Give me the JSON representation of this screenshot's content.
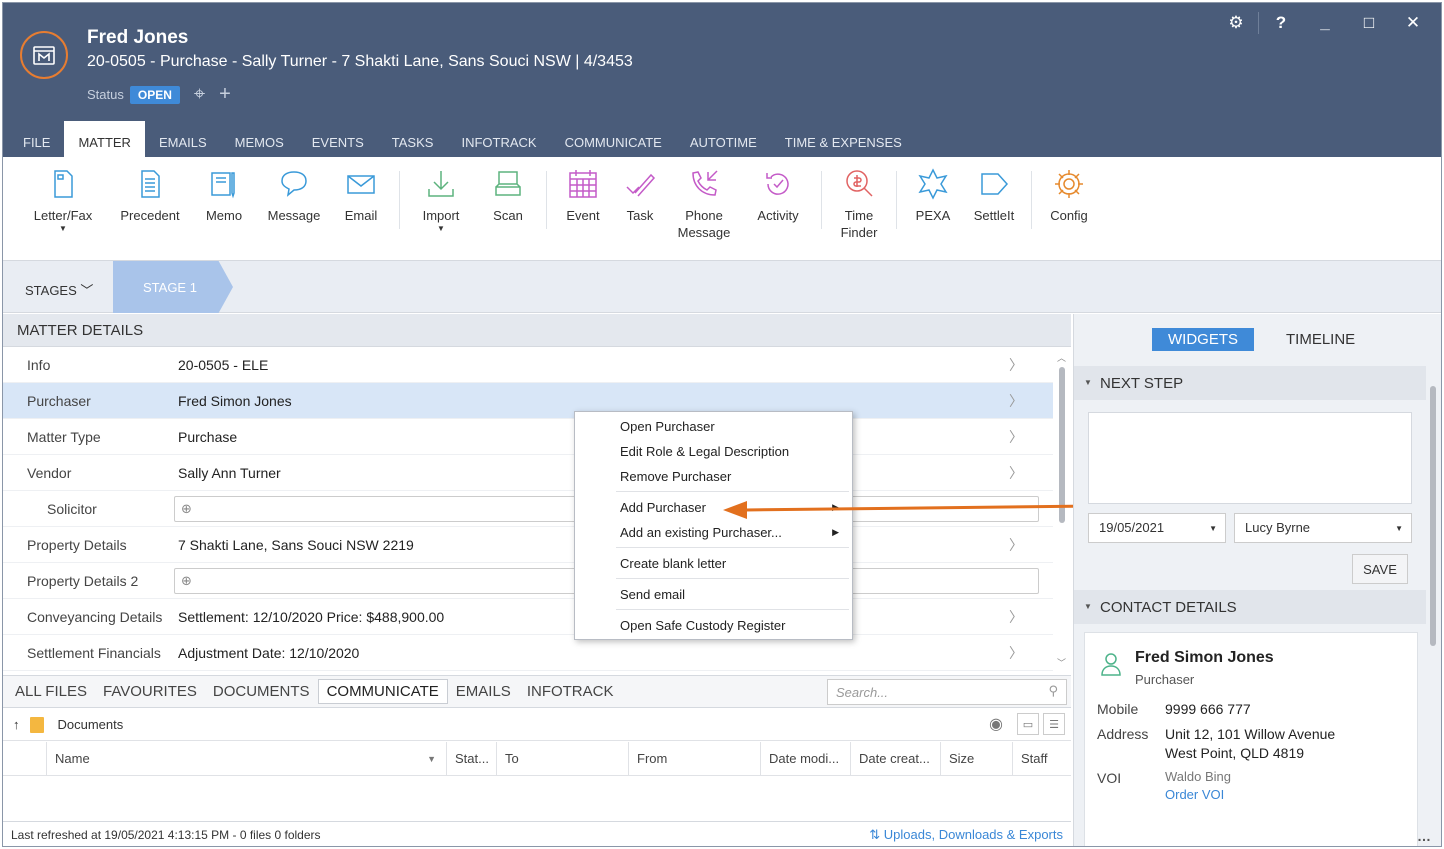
{
  "header": {
    "client_name": "Fred Jones",
    "matter_line": "20-0505 - Purchase - Sally Turner - 7 Shakti Lane, Sans Souci NSW | 4/3453",
    "status_label": "Status",
    "status_value": "OPEN",
    "window_help": "?",
    "window_minimize": "_",
    "window_maximize": "□",
    "window_close": "✕"
  },
  "menu_tabs": [
    "FILE",
    "MATTER",
    "EMAILS",
    "MEMOS",
    "EVENTS",
    "TASKS",
    "INFOTRACK",
    "COMMUNICATE",
    "AUTOTIME",
    "TIME & EXPENSES"
  ],
  "ribbon": {
    "letter_fax": "Letter/Fax",
    "precedent": "Precedent",
    "memo": "Memo",
    "message": "Message",
    "email": "Email",
    "import": "Import",
    "scan": "Scan",
    "event": "Event",
    "task": "Task",
    "phone_message_1": "Phone",
    "phone_message_2": "Message",
    "activity": "Activity",
    "time_finder_1": "Time",
    "time_finder_2": "Finder",
    "pexa": "PEXA",
    "settleit": "SettleIt",
    "config": "Config"
  },
  "stages": {
    "button": "STAGES",
    "current": "STAGE 1"
  },
  "matter_details": {
    "title": "MATTER DETAILS",
    "rows": [
      {
        "label": "Info",
        "value": "20-0505 - ELE"
      },
      {
        "label": "Purchaser",
        "value": "Fred Simon Jones"
      },
      {
        "label": "Matter Type",
        "value": "Purchase"
      },
      {
        "label": "Vendor",
        "value": "Sally Ann Turner"
      },
      {
        "label": "Solicitor",
        "value": ""
      },
      {
        "label": "Property Details",
        "value": "7 Shakti Lane, Sans Souci NSW 2219"
      },
      {
        "label": "Property Details 2",
        "value": ""
      },
      {
        "label": "Conveyancing Details",
        "value": "Settlement: 12/10/2020 Price: $488,900.00"
      },
      {
        "label": "Settlement Financials",
        "value": "Adjustment Date: 12/10/2020"
      }
    ]
  },
  "context_menu": {
    "items": [
      "Open Purchaser",
      "Edit Role & Legal Description",
      "Remove Purchaser",
      "Add Purchaser",
      "Add an existing Purchaser...",
      "Create blank letter",
      "Send email",
      "Open Safe Custody Register"
    ]
  },
  "files": {
    "tabs": [
      "ALL FILES",
      "FAVOURITES",
      "DOCUMENTS",
      "COMMUNICATE",
      "EMAILS",
      "INFOTRACK"
    ],
    "search_placeholder": "Search...",
    "path": "Documents",
    "columns": [
      "Name",
      "Stat...",
      "To",
      "From",
      "Date modi...",
      "Date creat...",
      "Size",
      "Staff"
    ],
    "status_text": "Last refreshed at 19/05/2021 4:13:15 PM  -  0 files 0 folders",
    "uploads_link": "Uploads, Downloads & Exports"
  },
  "right_panel": {
    "tabs": [
      "WIDGETS",
      "TIMELINE"
    ],
    "next_step_title": "NEXT STEP",
    "date_value": "19/05/2021",
    "staff_value": "Lucy Byrne",
    "save_label": "SAVE",
    "contact_title": "CONTACT DETAILS",
    "contact": {
      "name": "Fred Simon Jones",
      "role": "Purchaser",
      "mobile_label": "Mobile",
      "mobile": "9999 666 777",
      "address_label": "Address",
      "address_1": "Unit 12, 101 Willow Avenue",
      "address_2": "West Point, QLD 4819",
      "voi_label": "VOI",
      "voi_value": "Waldo Bing",
      "voi_link": "Order VOI"
    }
  },
  "colors": {
    "titlebar": "#4a5c7a",
    "accent": "#3f8ad8",
    "brand_orange": "#e77d31",
    "ribbon_icon": "#3a9ad9"
  }
}
